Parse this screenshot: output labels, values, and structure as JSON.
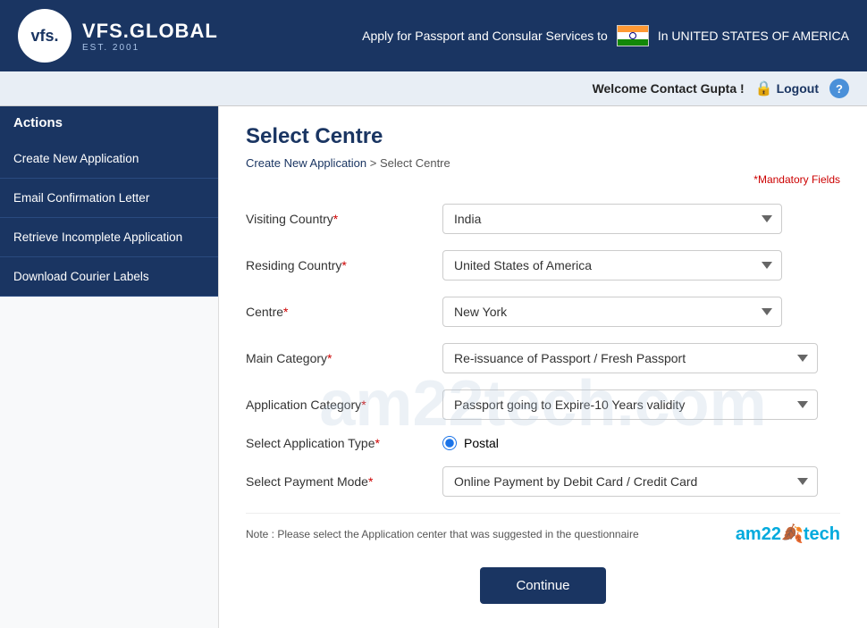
{
  "header": {
    "logo_initials": "vfs.",
    "logo_name": "VFS.GLOBAL",
    "logo_est": "EST. 2001",
    "tagline": "Apply for Passport and Consular Services to",
    "country": "INDIA",
    "location": "In UNITED STATES OF AMERICA"
  },
  "topbar": {
    "welcome": "Welcome Contact Gupta !",
    "logout": "Logout",
    "help": "?"
  },
  "sidebar": {
    "header": "Actions",
    "items": [
      {
        "label": "Create New Application",
        "id": "create-new"
      },
      {
        "label": "Email Confirmation Letter",
        "id": "email-confirm"
      },
      {
        "label": "Retrieve Incomplete Application",
        "id": "retrieve-incomplete"
      },
      {
        "label": "Download Courier Labels",
        "id": "download-courier"
      }
    ]
  },
  "page": {
    "title": "Select Centre",
    "breadcrumb_home": "Create New Application",
    "breadcrumb_sep": ">",
    "breadcrumb_current": "Select Centre",
    "mandatory_note": "*Mandatory Fields"
  },
  "form": {
    "visiting_country_label": "Visiting Country",
    "visiting_country_value": "India",
    "residing_country_label": "Residing Country",
    "residing_country_value": "United States of America",
    "centre_label": "Centre",
    "centre_value": "New York",
    "main_category_label": "Main Category",
    "main_category_value": "Re-issuance of Passport / Fresh Passport",
    "application_category_label": "Application Category",
    "application_category_value": "Passport going to Expire-10 Years validity",
    "application_type_label": "Select Application Type",
    "application_type_value": "Postal",
    "payment_mode_label": "Select Payment Mode",
    "payment_mode_value": "Online Payment by Debit Card / Credit Card",
    "note": "Note : Please select the Application center that was suggested in the questionnaire",
    "continue_btn": "Continue"
  },
  "watermark": "am22tech.com",
  "brand": {
    "am": "am",
    "num": "22",
    "leaf": "🍂",
    "tech": "tech"
  }
}
